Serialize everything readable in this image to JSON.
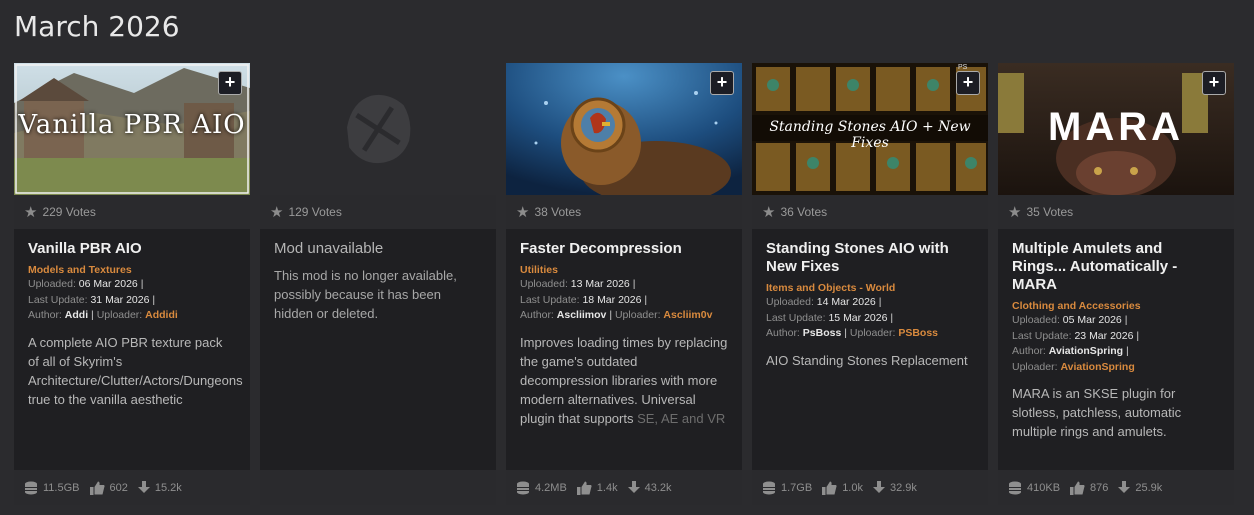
{
  "section": {
    "title": "March 2026"
  },
  "cards": [
    {
      "thumb_title": "Vanilla PBR AIO",
      "votes": "229 Votes",
      "title": "Vanilla PBR AIO",
      "category": "Models and Textures",
      "uploaded_label": "Uploaded:",
      "uploaded": "06 Mar 2026",
      "updated_label": "Last Update:",
      "updated": "31 Mar 2026",
      "author_label": "Author:",
      "author": "Addi",
      "uploader_label": "Uploader:",
      "uploader": "Addidi",
      "description": "A complete AIO PBR texture pack of all of Skyrim's Architecture/Clutter/Actors/Dungeons true to the vanilla aesthetic",
      "size": "11.5GB",
      "endorsements": "602",
      "downloads": "15.2k"
    },
    {
      "votes": "129 Votes",
      "title": "Mod unavailable",
      "description": "This mod is no longer available, possibly because it has been hidden or deleted."
    },
    {
      "votes": "38 Votes",
      "title": "Faster Decompression",
      "category": "Utilities",
      "uploaded_label": "Uploaded:",
      "uploaded": "13 Mar 2026",
      "updated_label": "Last Update:",
      "updated": "18 Mar 2026",
      "author_label": "Author:",
      "author": "Ascliimov",
      "uploader_label": "Uploader:",
      "uploader": "Ascliim0v",
      "description": "Improves loading times by replacing the game's outdated decompression libraries with more modern alternatives. Universal plugin that supports",
      "description_fade": "SE, AE and VR",
      "size": "4.2MB",
      "endorsements": "1.4k",
      "downloads": "43.2k"
    },
    {
      "thumb_title": "Standing Stones AIO + New Fixes",
      "thumb_badge": "PS",
      "votes": "36 Votes",
      "title": "Standing Stones AIO with New Fixes",
      "category": "Items and Objects - World",
      "uploaded_label": "Uploaded:",
      "uploaded": "14 Mar 2026",
      "updated_label": "Last Update:",
      "updated": "15 Mar 2026",
      "author_label": "Author:",
      "author": "PsBoss",
      "uploader_label": "Uploader:",
      "uploader": "PSBoss",
      "description": "AIO Standing Stones Replacement",
      "size": "1.7GB",
      "endorsements": "1.0k",
      "downloads": "32.9k"
    },
    {
      "thumb_title": "MARA",
      "votes": "35 Votes",
      "title": "Multiple Amulets and Rings... Automatically - MARA",
      "category": "Clothing and Accessories",
      "uploaded_label": "Uploaded:",
      "uploaded": "05 Mar 2026",
      "updated_label": "Last Update:",
      "updated": "23 Mar 2026",
      "author_label": "Author:",
      "author": "AviationSpring",
      "uploader_label": "Uploader:",
      "uploader": "AviationSpring",
      "description": "MARA is an SKSE plugin for slotless, patchless, automatic multiple rings and amulets.",
      "size": "410KB",
      "endorsements": "876",
      "downloads": "25.9k"
    }
  ],
  "icons": {
    "add": "+",
    "star": "★"
  },
  "colors": {
    "accent": "#d98a3e",
    "card_bg": "#1f1f22",
    "page_bg": "#2b2b2e"
  }
}
